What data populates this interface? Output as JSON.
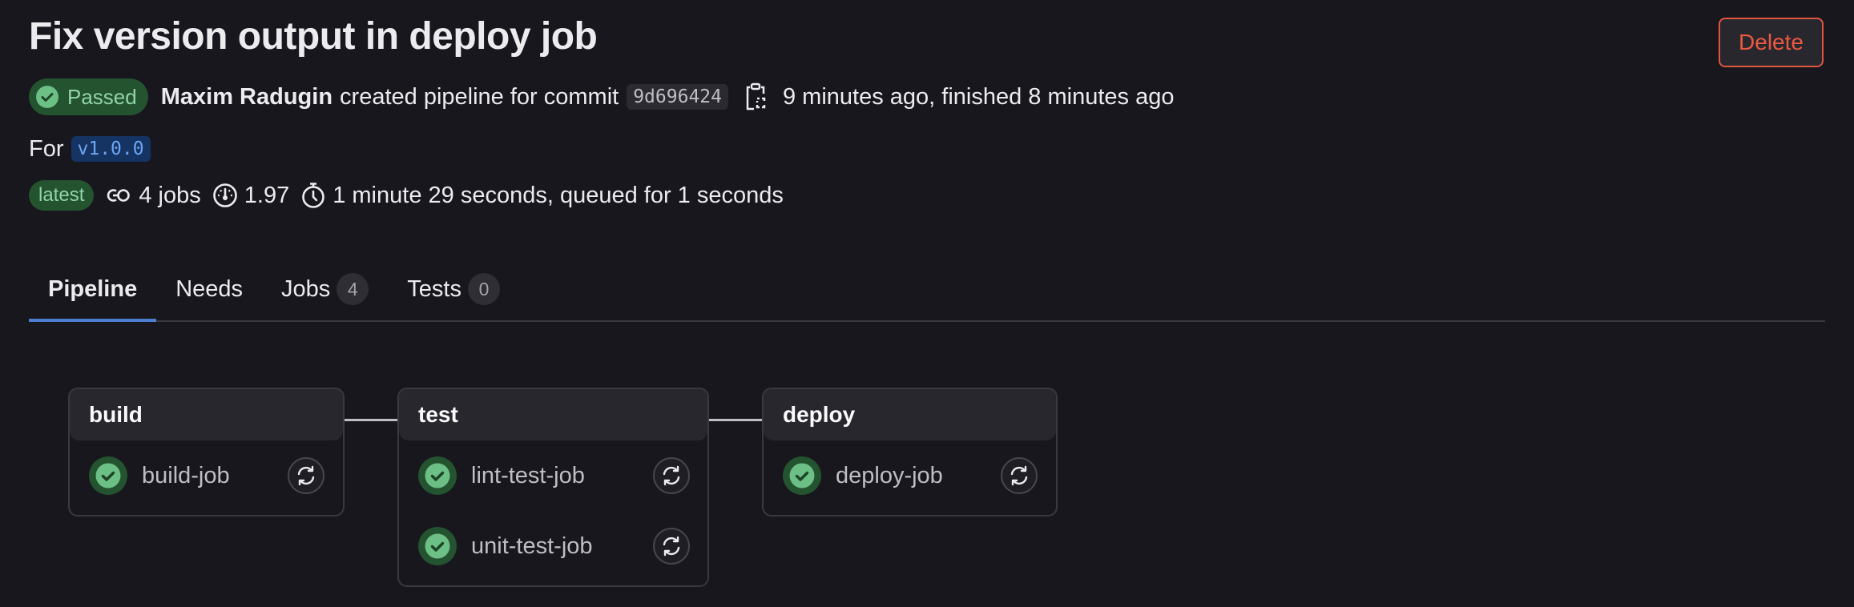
{
  "header": {
    "title": "Fix version output in deploy job",
    "delete_label": "Delete"
  },
  "status_row": {
    "status": "Passed",
    "author": "Maxim Radugin",
    "action_text": "created pipeline for commit",
    "commit_sha": "9d696424",
    "copy_icon": "clipboard-icon",
    "time_text": "9 minutes ago, finished 8 minutes ago"
  },
  "ref_row": {
    "label": "For",
    "ref": "v1.0.0"
  },
  "meta_row": {
    "latest_badge": "latest",
    "jobs": "4 jobs",
    "compute": "1.97",
    "duration": "1 minute 29 seconds, queued for 1 seconds"
  },
  "tabs": [
    {
      "label": "Pipeline",
      "active": true
    },
    {
      "label": "Needs"
    },
    {
      "label": "Jobs",
      "count": "4"
    },
    {
      "label": "Tests",
      "count": "0"
    }
  ],
  "stages": [
    {
      "name": "build",
      "jobs": [
        {
          "name": "build-job",
          "status": "success"
        }
      ]
    },
    {
      "name": "test",
      "jobs": [
        {
          "name": "lint-test-job",
          "status": "success"
        },
        {
          "name": "unit-test-job",
          "status": "success"
        }
      ]
    },
    {
      "name": "deploy",
      "jobs": [
        {
          "name": "deploy-job",
          "status": "success"
        }
      ]
    }
  ],
  "colors": {
    "background": "#18171d",
    "success_bg": "#24532f",
    "success_fg": "#91d4a8",
    "danger": "#ec5941",
    "tab_active": "#4d7fd1",
    "ref_bg": "#153463",
    "ref_fg": "#6ca6f2"
  }
}
